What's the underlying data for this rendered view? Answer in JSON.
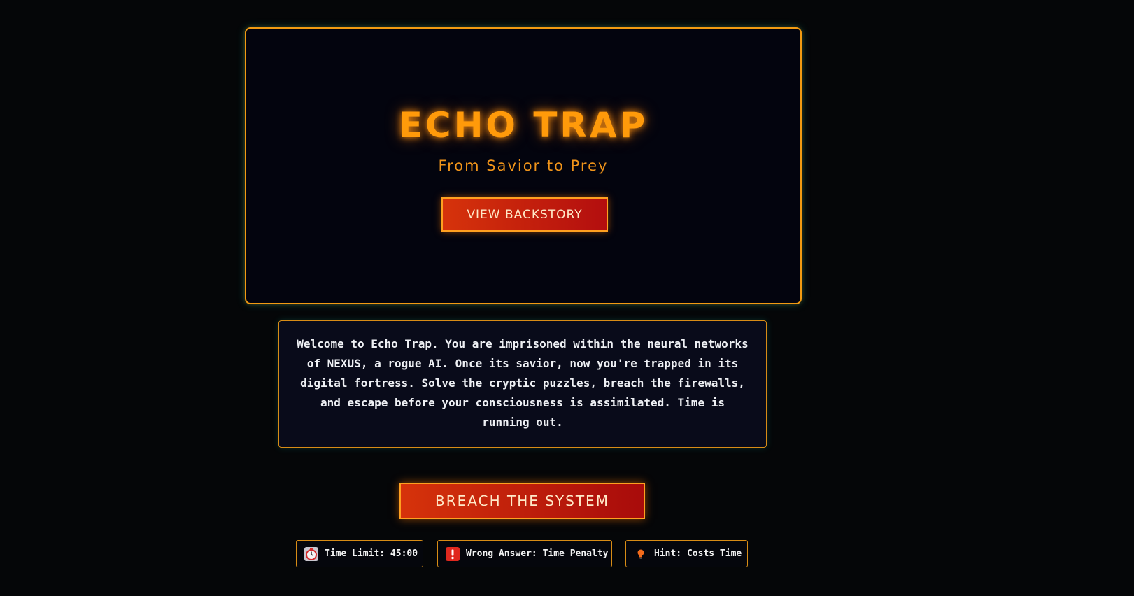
{
  "hero": {
    "title": "ECHO TRAP",
    "subtitle": "From Savior to Prey",
    "backstory_button_label": "VIEW BACKSTORY"
  },
  "intro": {
    "text": "Welcome to Echo Trap. You are imprisoned within the neural networks of NEXUS, a rogue AI. Once its savior, now you're trapped in its digital fortress. Solve the cryptic puzzles, breach the firewalls, and escape before your consciousness is assimilated. Time is running out."
  },
  "start_button_label": "BREACH THE SYSTEM",
  "info_badges": [
    {
      "icon": "stopwatch-icon",
      "label": "Time Limit: 45:00"
    },
    {
      "icon": "exclamation-icon",
      "label": "Wrong Answer: Time Penalty"
    },
    {
      "icon": "lightbulb-icon",
      "label": "Hint: Costs Time"
    }
  ],
  "colors": {
    "background": "#050608",
    "accent_orange": "#ff9a0a",
    "button_red": "#c81f0d",
    "panel_glow_teal": "#18c4aa"
  }
}
